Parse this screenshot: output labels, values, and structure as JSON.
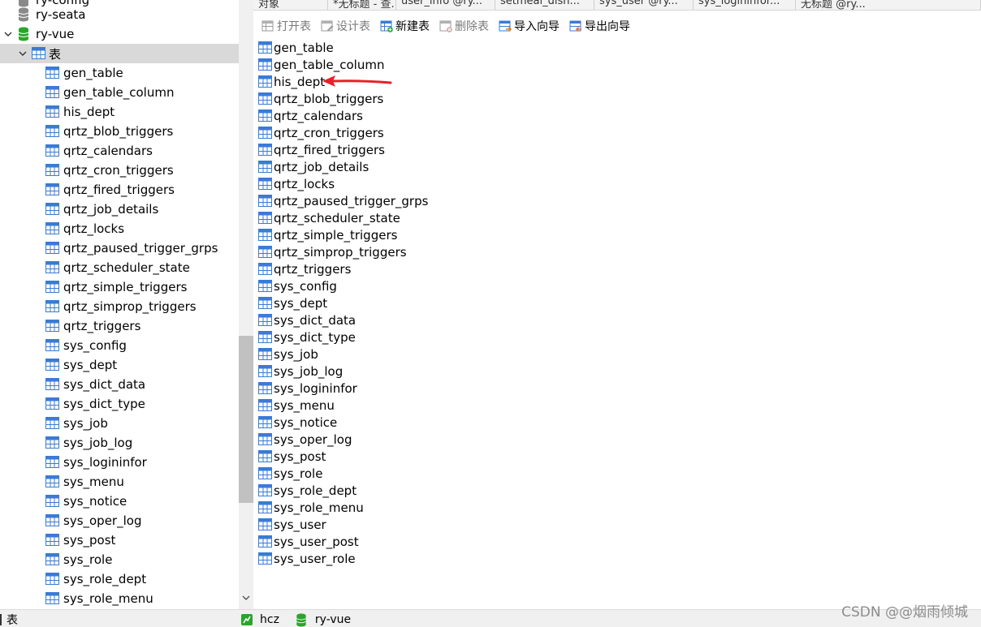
{
  "navigator": {
    "top_cut_label": "ry-config",
    "connections": [
      {
        "label": "ry-seata",
        "expanded": false
      },
      {
        "label": "ry-vue",
        "expanded": true
      }
    ],
    "tables_node_label": "表",
    "tables": [
      "gen_table",
      "gen_table_column",
      "his_dept",
      "qrtz_blob_triggers",
      "qrtz_calendars",
      "qrtz_cron_triggers",
      "qrtz_fired_triggers",
      "qrtz_job_details",
      "qrtz_locks",
      "qrtz_paused_trigger_grps",
      "qrtz_scheduler_state",
      "qrtz_simple_triggers",
      "qrtz_simprop_triggers",
      "qrtz_triggers",
      "sys_config",
      "sys_dept",
      "sys_dict_data",
      "sys_dict_type",
      "sys_job",
      "sys_job_log",
      "sys_logininfor",
      "sys_menu",
      "sys_notice",
      "sys_oper_log",
      "sys_post",
      "sys_role",
      "sys_role_dept",
      "sys_role_menu"
    ]
  },
  "tabs": [
    {
      "label": "对象"
    },
    {
      "label": "*无标题 - 查..."
    },
    {
      "label": "user_info @ry..."
    },
    {
      "label": "setmeal_dish..."
    },
    {
      "label": "sys_user @ry..."
    },
    {
      "label": "sys_logininfor..."
    },
    {
      "label": "无标题 @ry..."
    }
  ],
  "toolbar": {
    "open_table": "打开表",
    "design_table": "设计表",
    "new_table": "新建表",
    "delete_table": "删除表",
    "import_wizard": "导入向导",
    "export_wizard": "导出向导"
  },
  "object_list": [
    "gen_table",
    "gen_table_column",
    "his_dept",
    "qrtz_blob_triggers",
    "qrtz_calendars",
    "qrtz_cron_triggers",
    "qrtz_fired_triggers",
    "qrtz_job_details",
    "qrtz_locks",
    "qrtz_paused_trigger_grps",
    "qrtz_scheduler_state",
    "qrtz_simple_triggers",
    "qrtz_simprop_triggers",
    "qrtz_triggers",
    "sys_config",
    "sys_dept",
    "sys_dict_data",
    "sys_dict_type",
    "sys_job",
    "sys_job_log",
    "sys_logininfor",
    "sys_menu",
    "sys_notice",
    "sys_oper_log",
    "sys_post",
    "sys_role",
    "sys_role_dept",
    "sys_role_menu",
    "sys_user",
    "sys_user_post",
    "sys_user_role"
  ],
  "statusbar": {
    "left_label": "表",
    "connection": "hcz",
    "database": "ry-vue"
  },
  "watermark": "CSDN @@烟雨倾城",
  "colors": {
    "selection": "#d9d9d9",
    "annotation_arrow": "#e8202a",
    "db_active": "#2aa52a",
    "db_inactive": "#8a8a8a"
  }
}
